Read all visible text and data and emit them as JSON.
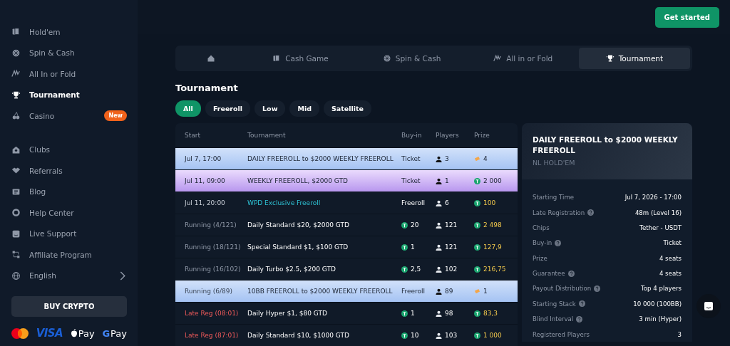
{
  "sidebar": {
    "groups": [
      [
        {
          "label": "Hold'em",
          "selected": false
        },
        {
          "label": "Spin & Cash",
          "selected": false
        },
        {
          "label": "All In or Fold",
          "selected": false
        },
        {
          "label": "Tournament",
          "selected": true
        },
        {
          "label": "Casino",
          "selected": false,
          "badge": "New"
        }
      ],
      [
        {
          "label": "Clubs",
          "selected": false
        },
        {
          "label": "Referrals",
          "selected": false
        },
        {
          "label": "Blog",
          "selected": false
        },
        {
          "label": "Help Center",
          "selected": false
        },
        {
          "label": "Live Support",
          "selected": false
        },
        {
          "label": "Affiliate Program",
          "selected": false
        },
        {
          "label": "English",
          "selected": false,
          "kind": "submenu"
        }
      ]
    ],
    "buy_button": "BUY CRYPTO",
    "payments": [
      {
        "kind": "mastercard"
      },
      {
        "kind": "visa",
        "label": "VISA"
      },
      {
        "kind": "apple",
        "label": "Pay"
      },
      {
        "kind": "google",
        "mark": "G",
        "label": "Pay"
      }
    ]
  },
  "header": {
    "cta": "Get started"
  },
  "tabs": [
    {
      "kind": "home",
      "selected": false
    },
    {
      "label": "Cash Game",
      "selected": false
    },
    {
      "label": "Spin & Cash",
      "selected": false
    },
    {
      "label": "All in or Fold",
      "selected": false
    },
    {
      "label": "Tournament",
      "selected": true
    }
  ],
  "section_title": "Tournament",
  "filters": [
    {
      "label": "All",
      "selected": true
    },
    {
      "label": "Freeroll",
      "selected": false
    },
    {
      "label": "Low",
      "selected": false
    },
    {
      "label": "Mid",
      "selected": false
    },
    {
      "label": "Satellite",
      "selected": false
    }
  ],
  "table": {
    "columns": [
      "Start",
      "Tournament",
      "Buy-in",
      "Players",
      "Prize"
    ],
    "rows": [
      {
        "kind": "satellite",
        "start": "Jul 7, 17:00",
        "running": false,
        "late": false,
        "name": "DAILY FREEROLL to $2000 WEEKLY FREEROLL",
        "featured": false,
        "buyin": {
          "kind": "plain",
          "text": "Ticket"
        },
        "players": "3",
        "prize": {
          "kind": "ticket",
          "text": "4"
        }
      },
      {
        "kind": "weekly",
        "start": "Jul 11, 09:00",
        "running": false,
        "late": false,
        "name": "WEEKLY FREEROLL, $2000 GTD",
        "featured": false,
        "buyin": {
          "kind": "plain",
          "text": "Ticket"
        },
        "players": "1",
        "prize": {
          "kind": "coin",
          "text": "2 000"
        }
      },
      {
        "kind": "standard",
        "start": "Jul 11, 20:00",
        "running": false,
        "late": false,
        "name": "WPD Exclusive Freeroll",
        "featured": true,
        "buyin": {
          "kind": "plain",
          "text": "Freeroll"
        },
        "players": "6",
        "prize": {
          "kind": "coin",
          "text": "100"
        }
      },
      {
        "kind": "standard",
        "start": "Running (4/121)",
        "running": true,
        "late": false,
        "name": "Daily Standard $20, $2000 GTD",
        "featured": false,
        "buyin": {
          "kind": "coin",
          "text": "20"
        },
        "players": "121",
        "prize": {
          "kind": "coin",
          "text": "2 498"
        }
      },
      {
        "kind": "standard",
        "start": "Running (18/121)",
        "running": true,
        "late": false,
        "name": "Special Standard $1, $100 GTD",
        "featured": false,
        "buyin": {
          "kind": "coin",
          "text": "1"
        },
        "players": "121",
        "prize": {
          "kind": "coin",
          "text": "127,9"
        }
      },
      {
        "kind": "standard",
        "start": "Running (16/102)",
        "running": true,
        "late": false,
        "name": "Daily Turbo $2.5, $200 GTD",
        "featured": false,
        "buyin": {
          "kind": "coin",
          "text": "2,5"
        },
        "players": "102",
        "prize": {
          "kind": "coin",
          "text": "216,75"
        }
      },
      {
        "kind": "satellite",
        "start": "Running (6/89)",
        "running": true,
        "late": false,
        "name": "10BB FREEROLL to $2000 WEEKLY FREEROLL",
        "featured": false,
        "buyin": {
          "kind": "plain",
          "text": "Freeroll"
        },
        "players": "89",
        "prize": {
          "kind": "ticket",
          "text": "1"
        }
      },
      {
        "kind": "standard",
        "start": "Late Reg (08:01)",
        "running": false,
        "late": true,
        "name": "Daily Hyper $1, $80 GTD",
        "featured": false,
        "buyin": {
          "kind": "coin",
          "text": "1"
        },
        "players": "98",
        "prize": {
          "kind": "coin",
          "text": "83,3"
        }
      },
      {
        "kind": "standard",
        "start": "Late Reg (87:01)",
        "running": false,
        "late": true,
        "name": "Daily Standard $10, $1000 GTD",
        "featured": false,
        "buyin": {
          "kind": "coin",
          "text": "10"
        },
        "players": "103",
        "prize": {
          "kind": "coin",
          "text": "1 000"
        }
      }
    ]
  },
  "details": {
    "title": "DAILY FREEROLL to $2000 WEEKLY FREEROLL",
    "subtitle": "NL HOLD'EM",
    "rows": [
      {
        "label": "Starting Time",
        "help": false,
        "value": "Jul 7, 2026 - 17:00"
      },
      {
        "label": "Late Registration",
        "help": true,
        "value": "48m (Level 16)"
      },
      {
        "label": "Chips",
        "help": false,
        "value": "Tether - USDT"
      },
      {
        "label": "Buy-in",
        "help": true,
        "value": "Ticket"
      },
      {
        "label": "Prize",
        "help": false,
        "value": "4 seats"
      },
      {
        "label": "Guarantee",
        "help": true,
        "value": "4 seats"
      },
      {
        "label": "Payout Distribution",
        "help": true,
        "value": "Top 4 players"
      },
      {
        "label": "Starting Stack",
        "help": true,
        "value": "10 000 (100BB)"
      },
      {
        "label": "Blind Interval",
        "help": true,
        "value": "3 min (Hyper)"
      },
      {
        "label": "Registered Players",
        "help": false,
        "value": "3"
      }
    ]
  }
}
